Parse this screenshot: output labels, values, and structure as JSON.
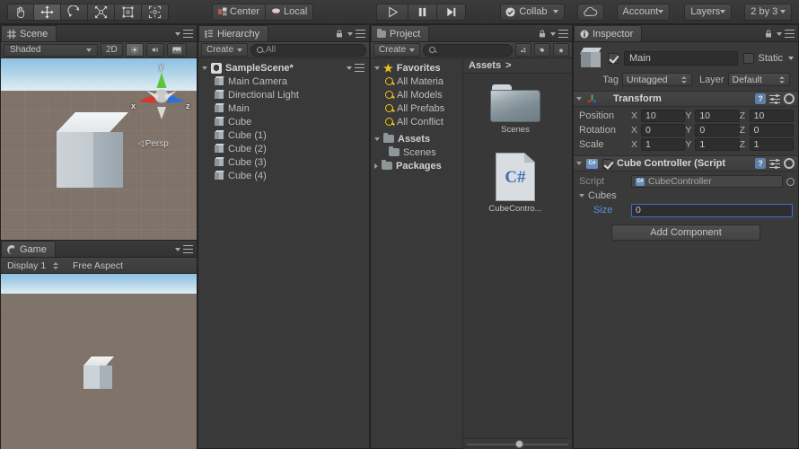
{
  "toolbar": {
    "tools": [
      {
        "name": "hand-tool",
        "icon": "hand",
        "active": false
      },
      {
        "name": "move-tool",
        "icon": "move",
        "active": true
      },
      {
        "name": "rotate-tool",
        "icon": "rotate",
        "active": false
      },
      {
        "name": "scale-tool",
        "icon": "scale",
        "active": false
      },
      {
        "name": "rect-tool",
        "icon": "rect",
        "active": false
      },
      {
        "name": "transform-tool",
        "icon": "transform",
        "active": false
      }
    ],
    "pivot_mode": "Center",
    "pivot_rotation": "Local",
    "play": "play-icon",
    "pause": "pause-icon",
    "step": "step-icon",
    "collab": "Collab",
    "cloud": "cloud-icon",
    "account": "Account",
    "layers": "Layers",
    "layout": "2 by 3"
  },
  "scene": {
    "tab": "Scene",
    "shading": "Shaded",
    "two_d": "2D",
    "lighting_icon": "sun-icon",
    "audio_icon": "audio-icon",
    "fx_icon": "image-icon",
    "persp_label": "Persp",
    "gizmo_axes": [
      "y",
      "x",
      "z"
    ],
    "gizmo_colors": {
      "x": "#d03b2e",
      "y": "#5bc63a",
      "z": "#2f6ed6"
    }
  },
  "game": {
    "tab": "Game",
    "display": "Display 1",
    "aspect": "Free Aspect"
  },
  "hierarchy": {
    "tab": "Hierarchy",
    "create_label": "Create",
    "search_placeholder": "All",
    "scene_name": "SampleScene*",
    "objects": [
      {
        "label": "Main Camera"
      },
      {
        "label": "Directional Light"
      },
      {
        "label": "Main"
      },
      {
        "label": "Cube"
      },
      {
        "label": "Cube (1)"
      },
      {
        "label": "Cube (2)"
      },
      {
        "label": "Cube (3)"
      },
      {
        "label": "Cube (4)"
      }
    ]
  },
  "project": {
    "tab": "Project",
    "create_label": "Create",
    "search_placeholder": "",
    "favorites_label": "Favorites",
    "favorites": [
      {
        "label": "All Materia"
      },
      {
        "label": "All Models"
      },
      {
        "label": "All Prefabs"
      },
      {
        "label": "All Conflict"
      }
    ],
    "assets_label": "Assets",
    "tree": [
      {
        "label": "Scenes",
        "indent": 1
      }
    ],
    "packages_label": "Packages",
    "breadcrumb": "Assets",
    "breadcrumb_sep": ">",
    "items": [
      {
        "label": "Scenes",
        "type": "folder"
      },
      {
        "label": "CubeContro...",
        "type": "csharp",
        "icon_text": "C#"
      }
    ]
  },
  "inspector": {
    "tab": "Inspector",
    "object_name": "Main",
    "object_enabled": true,
    "static_label": "Static",
    "tag_label": "Tag",
    "tag_value": "Untagged",
    "layer_label": "Layer",
    "layer_value": "Default",
    "transform": {
      "title": "Transform",
      "rows": [
        {
          "name": "Position",
          "x": "10",
          "y": "10",
          "z": "10"
        },
        {
          "name": "Rotation",
          "x": "0",
          "y": "0",
          "z": "0"
        },
        {
          "name": "Scale",
          "x": "1",
          "y": "1",
          "z": "1"
        }
      ],
      "axis_labels": [
        "X",
        "Y",
        "Z"
      ]
    },
    "script_component": {
      "title": "Cube Controller (Script",
      "enabled": true,
      "script_label": "Script",
      "script_value": "CubeController",
      "array_label": "Cubes",
      "size_label": "Size",
      "size_value": "0"
    },
    "add_component": "Add Component"
  }
}
